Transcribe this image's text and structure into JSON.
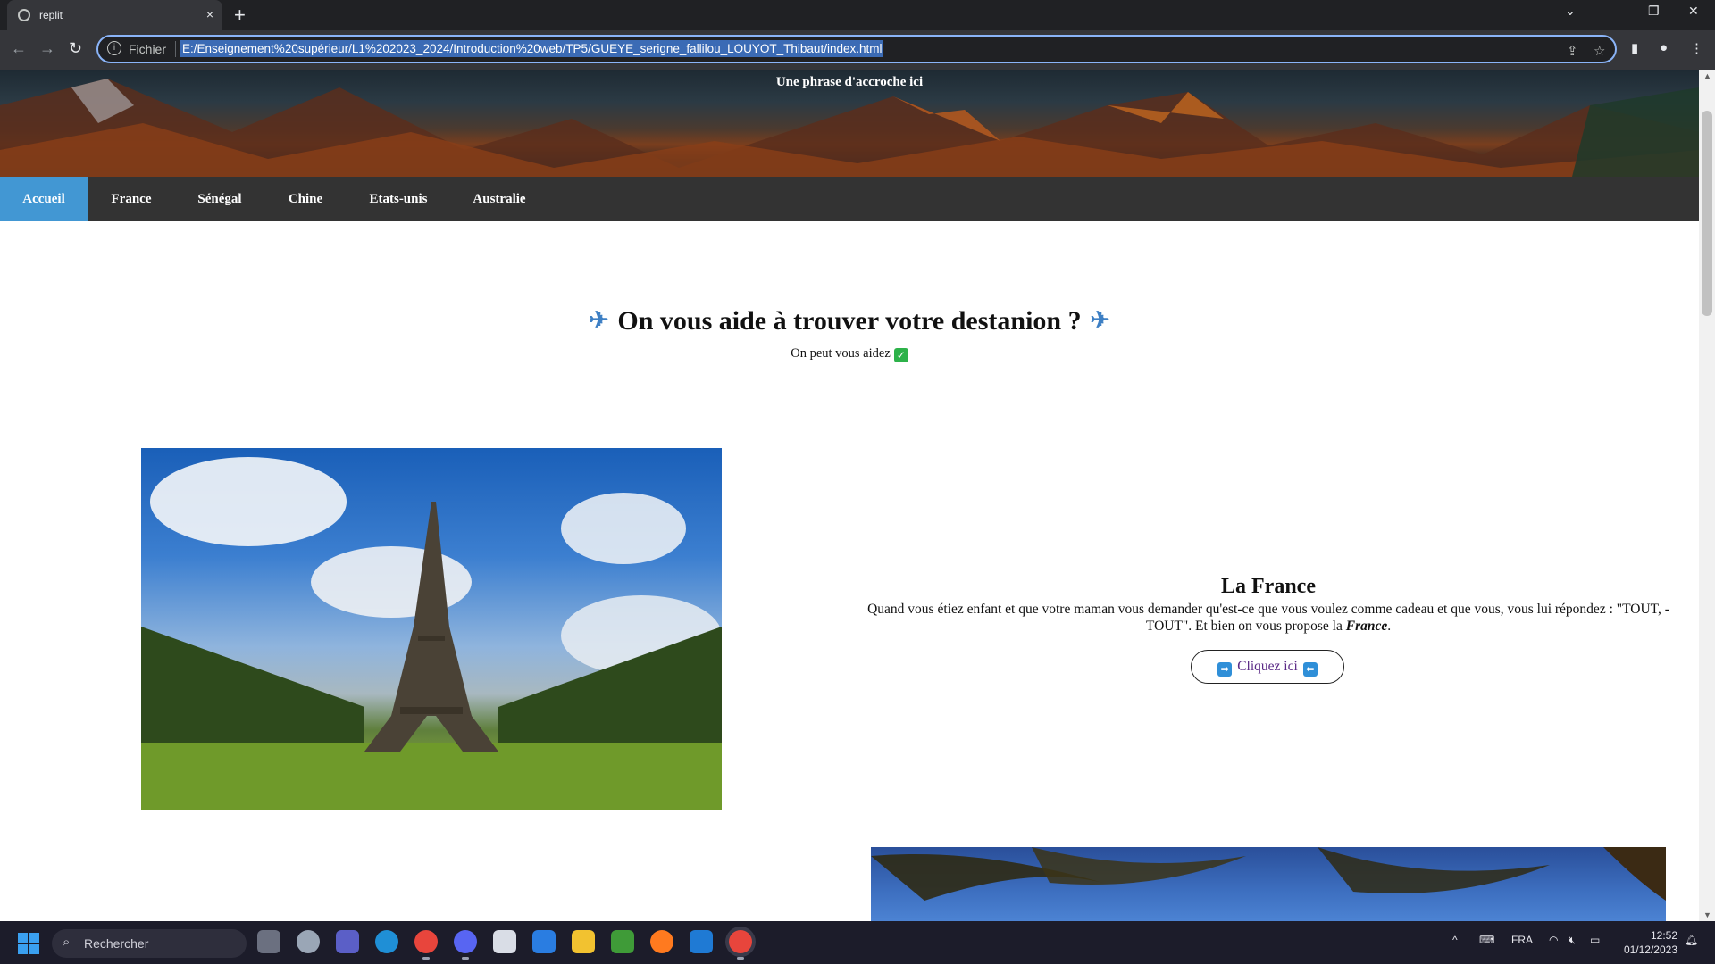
{
  "browser": {
    "tab_title": "replit",
    "tab_close": "×",
    "new_tab": "+",
    "address_scheme_label": "Fichier",
    "url": "E:/Enseignement%20supérieur/L1%202023_2024/Introduction%20web/TP5/GUEYE_serigne_fallilou_LOUYOT_Thibaut/index.html"
  },
  "page": {
    "tagline": "Une phrase d'accroche ici",
    "nav": [
      "Accueil",
      "France",
      "Sénégal",
      "Chine",
      "Etats-unis",
      "Australie"
    ],
    "active_nav": "Accueil",
    "headline": "On vous aide à trouver votre destanion ?",
    "subline": "On peut vous aidez",
    "destination_card": {
      "title": "La France",
      "text_before": "Quand vous étiez enfant et que votre maman vous demander qu'est-ce que vous voulez comme cadeau et que vous, vous lui répondez : \"TOUT, -TOUT\". Et bien on vous propose la ",
      "emphasis": "France",
      "text_after": ".",
      "button_label": "Cliquez ici"
    }
  },
  "taskbar": {
    "search_placeholder": "Rechercher",
    "language": "FRA",
    "time": "12:52",
    "date": "01/12/2023"
  },
  "colors": {
    "nav_bg": "#333333",
    "nav_active": "#4297d3",
    "omnibox_focus": "#8ab4f8",
    "button_text": "#5b2a86"
  }
}
